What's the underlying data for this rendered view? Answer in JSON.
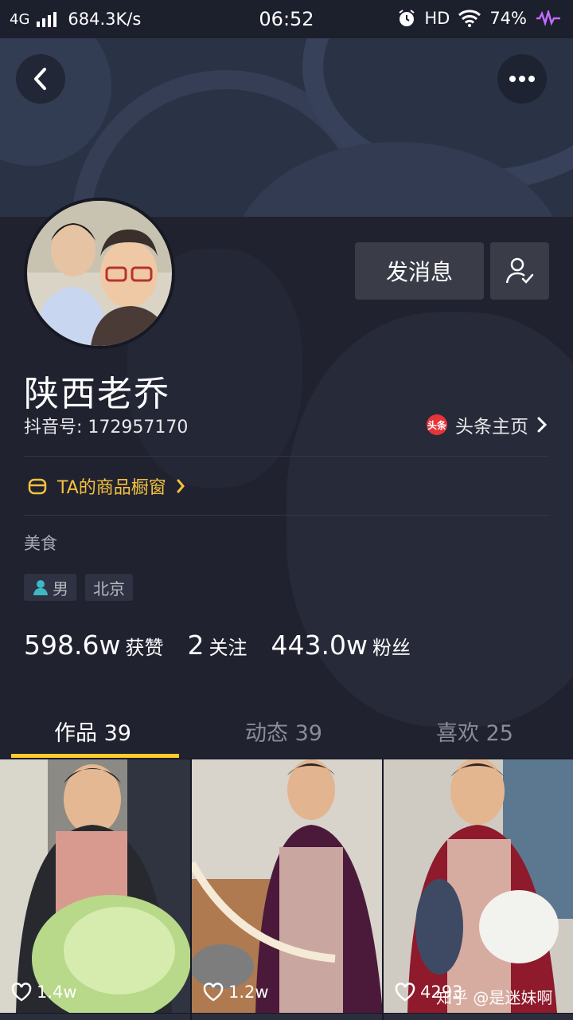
{
  "status_bar": {
    "network": "4G",
    "speed": "684.3K/s",
    "time": "06:52",
    "hd": "HD",
    "battery": "74%"
  },
  "header": {
    "back_icon": "chevron-left-icon",
    "more_icon": "more-dots-icon"
  },
  "profile": {
    "message_button": "发消息",
    "follow_icon": "user-check-icon",
    "name": "陕西老乔",
    "douyin_id": "抖音号: 172957170",
    "toutiao_logo": "头条",
    "toutiao_link": "头条主页",
    "shop_link": "TA的商品橱窗",
    "category": "美食",
    "tags": [
      {
        "label": "男",
        "icon": "person-icon"
      },
      {
        "label": "北京"
      }
    ]
  },
  "stats": [
    {
      "value": "598.6w",
      "label": "获赞"
    },
    {
      "value": "2",
      "label": "关注"
    },
    {
      "value": "443.0w",
      "label": "粉丝"
    }
  ],
  "tabs": [
    {
      "label": "作品 39",
      "active": true
    },
    {
      "label": "动态 39",
      "active": false
    },
    {
      "label": "喜欢 25",
      "active": false
    }
  ],
  "videos": [
    {
      "likes": "1.4w"
    },
    {
      "likes": "1.2w"
    },
    {
      "likes": "4293"
    }
  ],
  "watermark": "知乎 @是迷妹啊",
  "colors": {
    "background": "#161823",
    "accent": "#fecc2c",
    "shop": "#f5c23c",
    "toutiao_red": "#e5353a"
  }
}
